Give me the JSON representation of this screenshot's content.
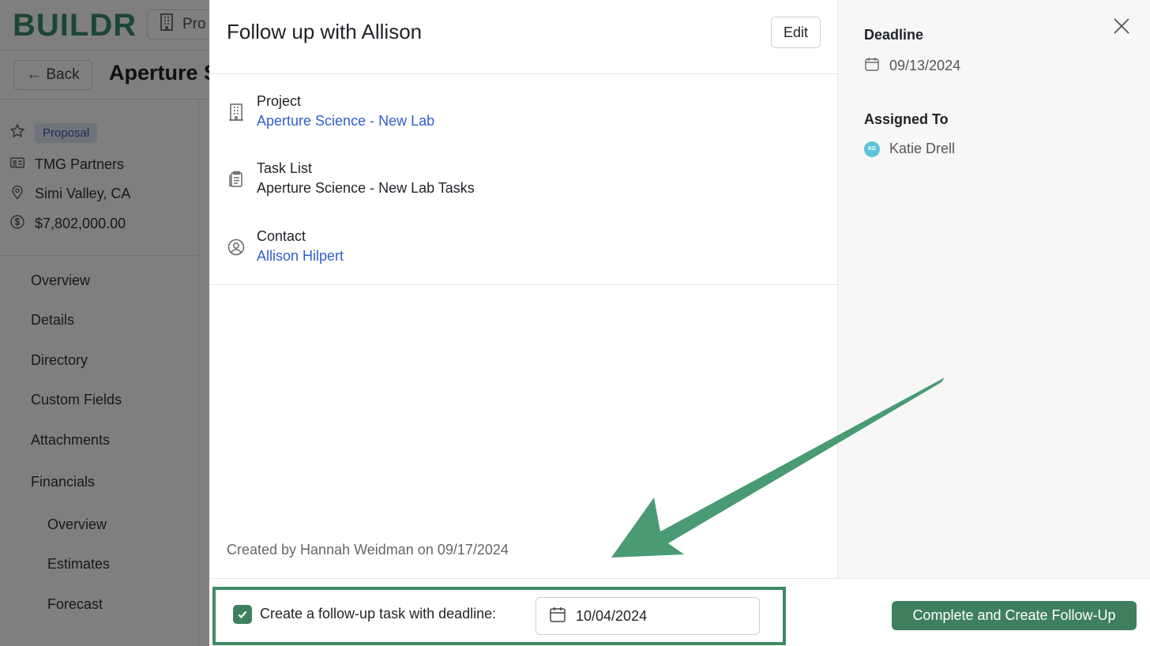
{
  "app": {
    "logo": "BUILDR",
    "project_select": "Pro",
    "back_label": "Back",
    "page_title": "Aperture S",
    "status_badge": "Proposal",
    "company": "TMG Partners",
    "location": "Simi Valley, CA",
    "value": "$7,802,000.00",
    "nav": [
      {
        "label": "Overview"
      },
      {
        "label": "Details"
      },
      {
        "label": "Directory"
      },
      {
        "label": "Custom Fields"
      },
      {
        "label": "Attachments"
      },
      {
        "label": "Financials"
      }
    ],
    "nav_sub": [
      {
        "label": "Overview"
      },
      {
        "label": "Estimates"
      },
      {
        "label": "Forecast"
      }
    ]
  },
  "modal": {
    "title": "Follow up with Allison",
    "edit_label": "Edit",
    "project_label": "Project",
    "project_value": "Aperture Science - New Lab",
    "tasklist_label": "Task List",
    "tasklist_value": "Aperture Science - New Lab Tasks",
    "contact_label": "Contact",
    "contact_value": "Allison Hilpert",
    "created_text": "Created by Hannah Weidman on 09/17/2024",
    "deadline_label": "Deadline",
    "deadline_value": "09/13/2024",
    "assigned_label": "Assigned To",
    "assigned_initials": "KD",
    "assigned_value": "Katie Drell"
  },
  "footer": {
    "followup_checked": true,
    "followup_label": "Create a follow-up task with deadline:",
    "followup_date": "10/04/2024",
    "complete_label": "Complete and Create Follow-Up"
  },
  "colors": {
    "brand_green": "#3e7f5e",
    "link_blue": "#2f5fcf",
    "annotation_green": "#3e8b66"
  }
}
